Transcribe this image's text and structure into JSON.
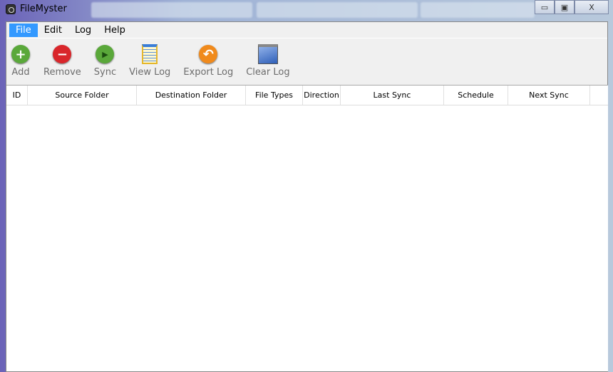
{
  "window": {
    "title": "FileMyster",
    "minimize": "▭",
    "maximize": "▣",
    "close": "X"
  },
  "menu": [
    {
      "label": "File"
    },
    {
      "label": "Edit"
    },
    {
      "label": "Log"
    },
    {
      "label": "Help"
    }
  ],
  "toolbar": [
    {
      "label": "Add",
      "icon": "add-icon",
      "color": "#5aa83a",
      "glyph": "+"
    },
    {
      "label": "Remove",
      "icon": "remove-icon",
      "color": "#d9262b",
      "glyph": "−"
    },
    {
      "label": "Sync",
      "icon": "play-icon",
      "color": "#5aa83a",
      "glyph": "▶"
    },
    {
      "label": "View Log",
      "icon": "notepad-icon"
    },
    {
      "label": "Export Log",
      "icon": "undo-arrow-icon",
      "color": "#f08a1c",
      "glyph": "↶"
    },
    {
      "label": "Clear Log",
      "icon": "blue-square-icon"
    }
  ],
  "table": {
    "columns": [
      "ID",
      "Source Folder",
      "Destination Folder",
      "File Types",
      "Direction",
      "Last Sync",
      "Schedule",
      "Next Sync"
    ],
    "rows": []
  }
}
